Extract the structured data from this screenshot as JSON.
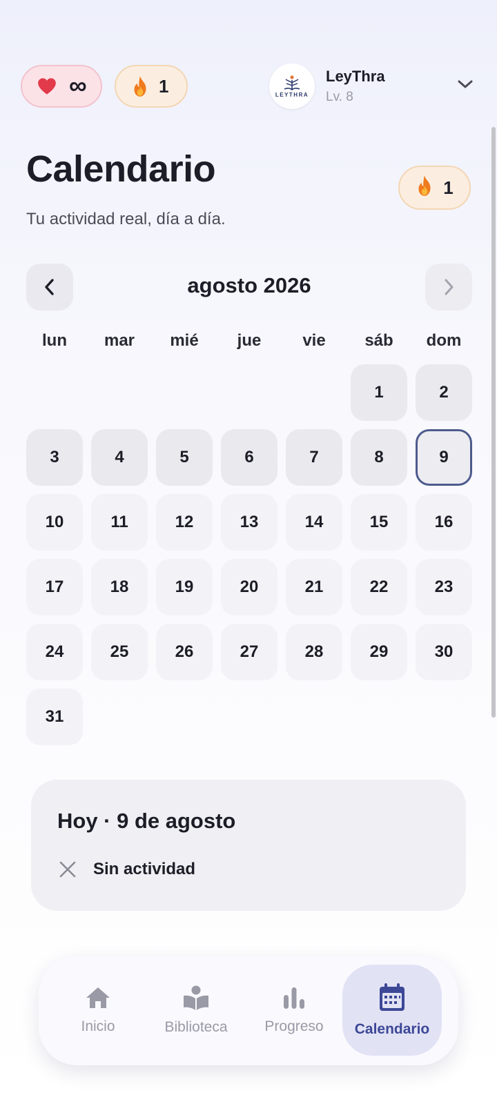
{
  "topbar": {
    "lives_value": "∞",
    "streak_value": "1",
    "user": {
      "name": "LeyThra",
      "level": "Lv. 8",
      "avatar_text": "LEYTHRA"
    }
  },
  "header": {
    "title": "Calendario",
    "subtitle": "Tu actividad real, día a día.",
    "streak_value": "1"
  },
  "calendar": {
    "month_label": "agosto 2026",
    "weekdays": [
      "lun",
      "mar",
      "mié",
      "jue",
      "vie",
      "sáb",
      "dom"
    ],
    "today": 9,
    "days": [
      "1",
      "2",
      "3",
      "4",
      "5",
      "6",
      "7",
      "8",
      "9",
      "10",
      "11",
      "12",
      "13",
      "14",
      "15",
      "16",
      "17",
      "18",
      "19",
      "20",
      "21",
      "22",
      "23",
      "24",
      "25",
      "26",
      "27",
      "28",
      "29",
      "30",
      "31"
    ]
  },
  "summary": {
    "title": "Hoy · 9 de agosto",
    "status": "Sin actividad"
  },
  "bottom_nav": {
    "items": [
      {
        "label": "Inicio",
        "icon": "home-icon"
      },
      {
        "label": "Biblioteca",
        "icon": "book-reader-icon"
      },
      {
        "label": "Progreso",
        "icon": "bar-chart-icon"
      },
      {
        "label": "Calendario",
        "icon": "calendar-icon"
      }
    ]
  },
  "colors": {
    "accent": "#3c4896",
    "today_border": "#4d5a8c",
    "heart": "#e23a4a",
    "flame": "#f07a1e"
  }
}
